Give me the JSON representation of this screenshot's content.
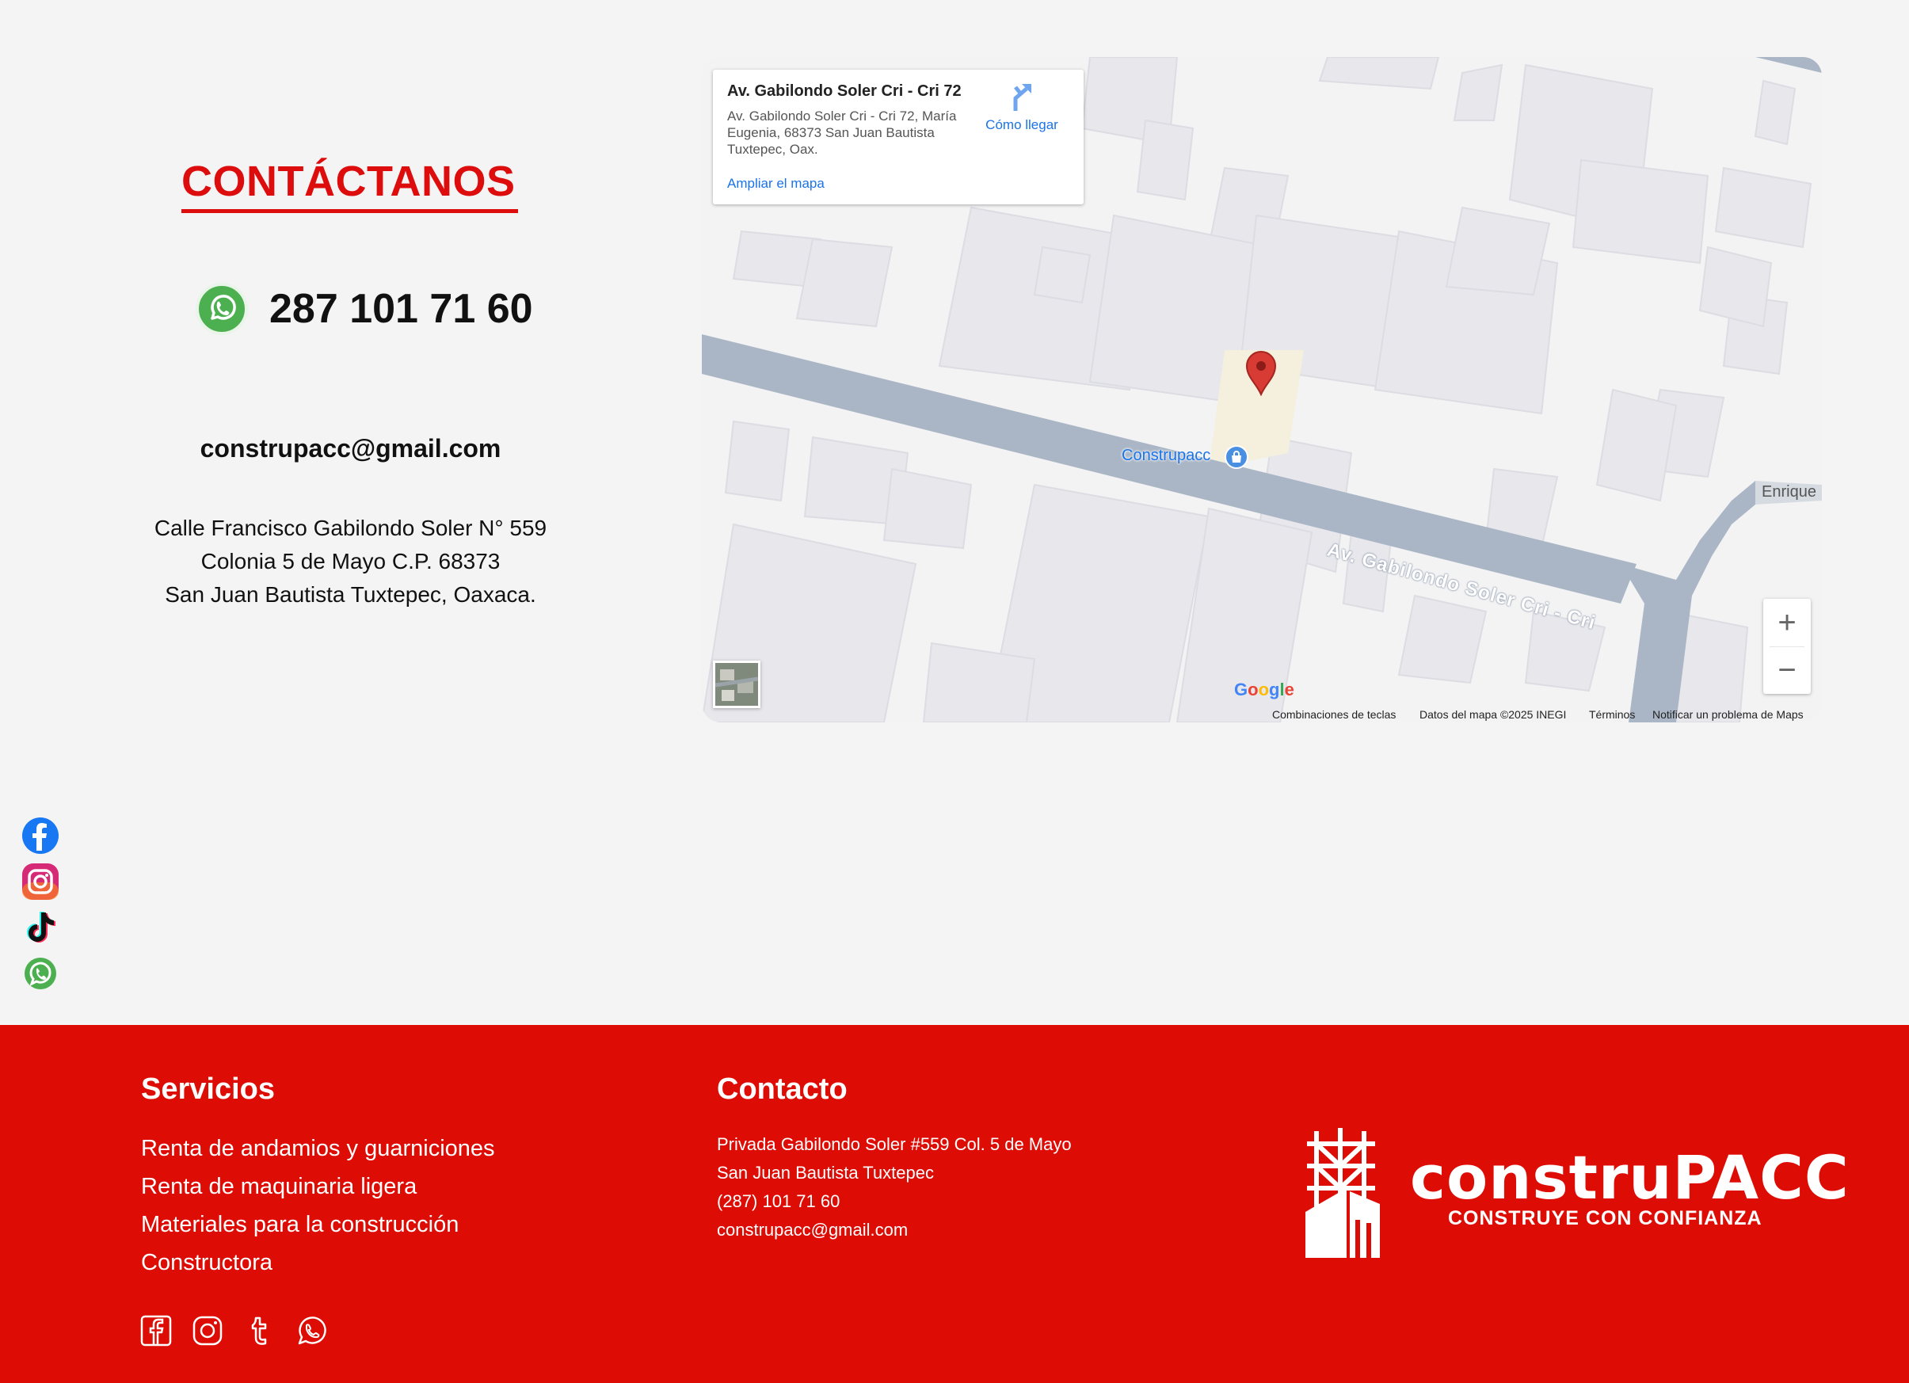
{
  "contact": {
    "title": "CONTÁCTANOS",
    "phone": "287 101 71 60",
    "email": "construpacc@gmail.com",
    "address_lines": [
      "Calle Francisco Gabilondo Soler N° 559",
      "Colonia 5 de Mayo C.P. 68373",
      "San Juan Bautista Tuxtepec, Oaxaca."
    ]
  },
  "map": {
    "card_title": "Av. Gabilondo Soler Cri - Cri 72",
    "card_address": "Av. Gabilondo Soler Cri - Cri 72, María Eugenia, 68373 San Juan Bautista Tuxtepec, Oax.",
    "directions_label": "Cómo llegar",
    "enlarge_label": "Ampliar el mapa",
    "place_label": "Construpacc",
    "street_label": "Av. Gabilondo Soler Cri - Cri",
    "street_label_2": "Enrique",
    "zoom_in": "+",
    "zoom_out": "−",
    "google_logo": "Google",
    "footer": {
      "shortcuts": "Combinaciones de teclas",
      "data": "Datos del mapa ©2025 INEGI",
      "terms": "Términos",
      "report": "Notificar un problema de Maps"
    }
  },
  "floating_social": [
    "facebook-icon",
    "instagram-icon",
    "tiktok-icon",
    "whatsapp-icon"
  ],
  "footer": {
    "services_heading": "Servicios",
    "services": [
      "Renta de andamios y guarniciones",
      "Renta de maquinaria ligera",
      "Materiales para la construcción",
      "Constructora"
    ],
    "contact_heading": "Contacto",
    "contact_lines": [
      "Privada Gabilondo Soler #559 Col. 5 de Mayo",
      "San Juan Bautista Tuxtepec",
      "(287) 101 71 60",
      "construpacc@gmail.com"
    ],
    "social": [
      "facebook-icon",
      "instagram-icon",
      "tumblr-icon",
      "whatsapp-icon"
    ],
    "logo_word": "construPACC",
    "logo_tagline": "CONSTRUYE CON CONFIANZA"
  },
  "colors": {
    "brand_red": "#dd0d05",
    "title_red": "#dd0d0d",
    "link_blue": "#1a73e8",
    "road": "#aab6c5"
  }
}
